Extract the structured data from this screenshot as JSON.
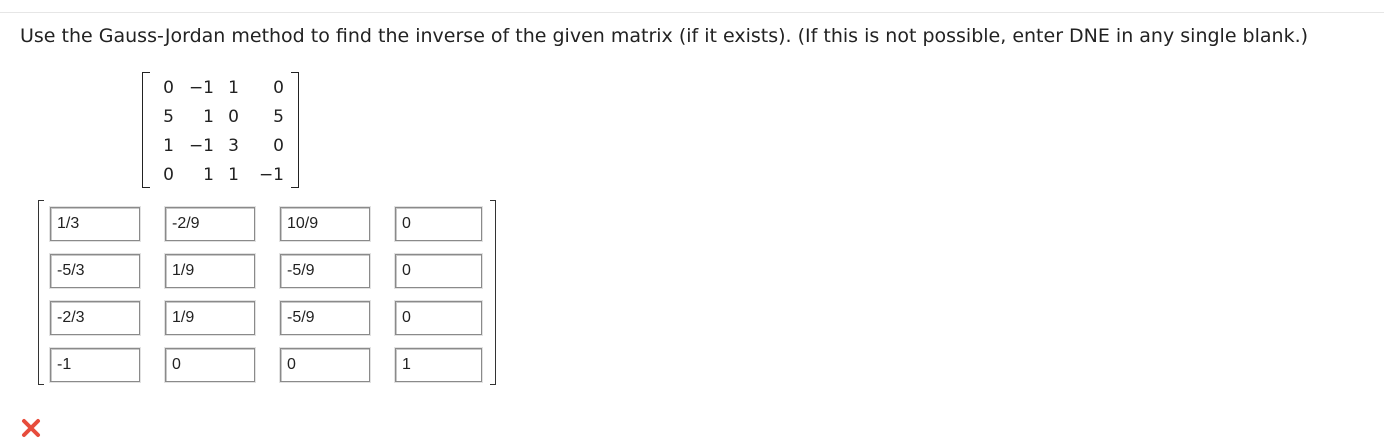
{
  "question": {
    "text": "Use the Gauss-Jordan method to find the inverse of the given matrix (if it exists). (If this is not possible, enter DNE in any single blank.)"
  },
  "given_matrix": {
    "rows": [
      [
        "0",
        "−1",
        "1",
        "0"
      ],
      [
        "5",
        "1",
        "0",
        "5"
      ],
      [
        "1",
        "−1",
        "3",
        "0"
      ],
      [
        "0",
        "1",
        "1",
        "−1"
      ]
    ]
  },
  "answer_matrix": {
    "rows": [
      [
        "1/3",
        "-2/9",
        "10/9",
        "0"
      ],
      [
        "-5/3",
        "1/9",
        "-5/9",
        "0"
      ],
      [
        "-2/3",
        "1/9",
        "-5/9",
        "0"
      ],
      [
        "-1",
        "0",
        "0",
        "1"
      ]
    ]
  },
  "status": {
    "icon": "incorrect-x-icon",
    "color": "#e74c3c"
  }
}
